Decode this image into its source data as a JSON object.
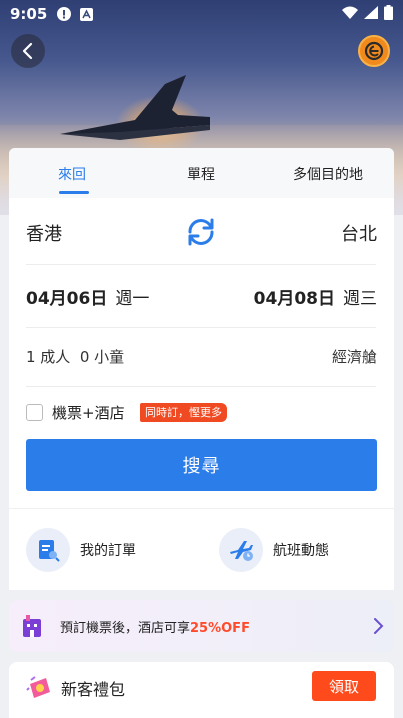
{
  "status_bar": {
    "time": "9:05"
  },
  "tabs": [
    {
      "label": "來回",
      "active": true
    },
    {
      "label": "單程",
      "active": false
    },
    {
      "label": "多個目的地",
      "active": false
    }
  ],
  "route": {
    "from": "香港",
    "to": "台北"
  },
  "dates": {
    "depart": {
      "date": "04月06日",
      "weekday": "週一"
    },
    "return": {
      "date": "04月08日",
      "weekday": "週三"
    }
  },
  "passengers": {
    "label": "1 成人  0 小童",
    "cabin": "經濟艙"
  },
  "bundle": {
    "label": "機票+酒店",
    "tag": "同時訂，慳更多"
  },
  "search_label": "搜尋",
  "quick_links": [
    {
      "label": "我的訂單",
      "icon": "order-icon"
    },
    {
      "label": "航班動態",
      "icon": "flight-status-icon"
    }
  ],
  "banner": {
    "text_prefix": "預訂機票後，酒店可享",
    "highlight": "25%OFF"
  },
  "gift": {
    "label": "新客禮包",
    "button": "領取"
  },
  "colors": {
    "accent": "#2b7de9",
    "promo": "#f04a22",
    "brand": "#f08a1c"
  }
}
